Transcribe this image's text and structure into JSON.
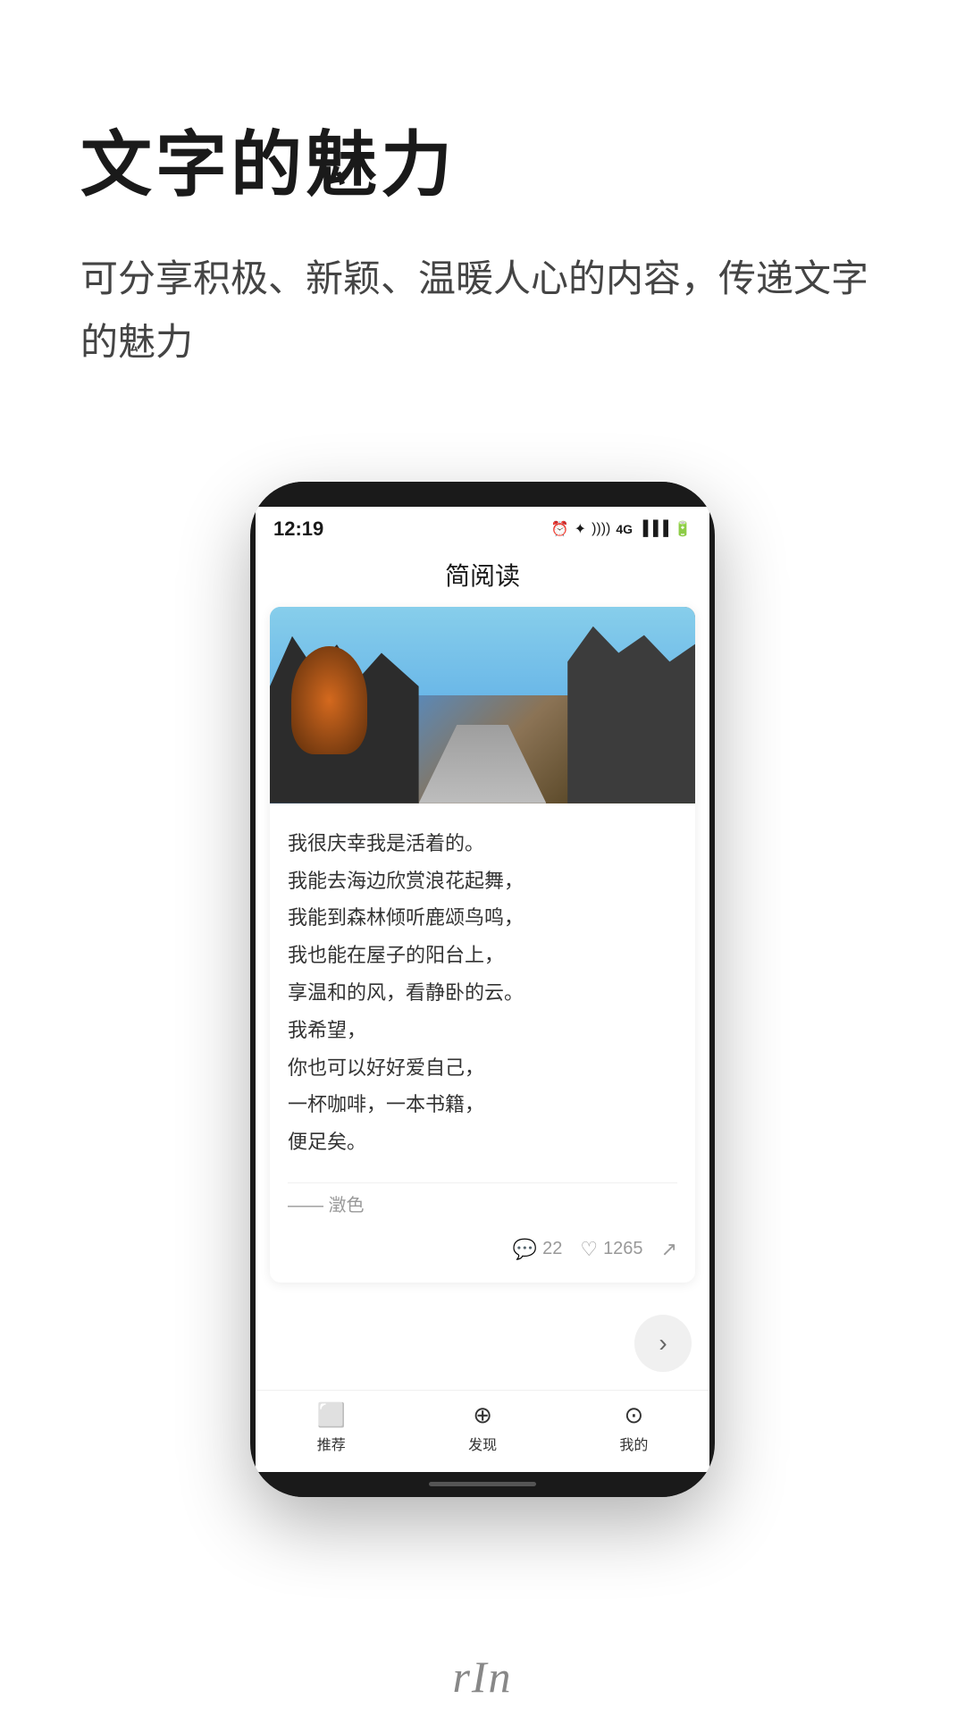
{
  "page": {
    "background": "#ffffff"
  },
  "top_section": {
    "main_title": "文字的魅力",
    "sub_text": "可分享积极、新颖、温暖人心的内容，传递文字的魅力"
  },
  "phone": {
    "status_bar": {
      "time": "12:19",
      "nfc_icon": "N",
      "icons": "⏰ ✦ ))) ≋ ▲ ▲ 🔋"
    },
    "app_title": "简阅读",
    "article": {
      "image_alt": "秋季街道景色",
      "text_lines": [
        "我很庆幸我是活着的。",
        "我能去海边欣赏浪花起舞，",
        "我能到森林倾听鹿颂鸟鸣，",
        "我也能在屋子的阳台上，",
        "享温和的风，看静卧的云。",
        "我希望，",
        "你也可以好好爱自己，",
        "一杯咖啡，一本书籍，",
        "便足矣。"
      ],
      "author": "—— 澂色",
      "comment_count": "22",
      "like_count": "1265"
    },
    "bottom_nav": {
      "items": [
        {
          "icon": "📺",
          "label": "推荐",
          "id": "recommend"
        },
        {
          "icon": "🧭",
          "label": "发现",
          "id": "discover"
        },
        {
          "icon": "👤",
          "label": "我的",
          "id": "profile"
        }
      ]
    }
  },
  "watermark": {
    "text": "rIn"
  }
}
